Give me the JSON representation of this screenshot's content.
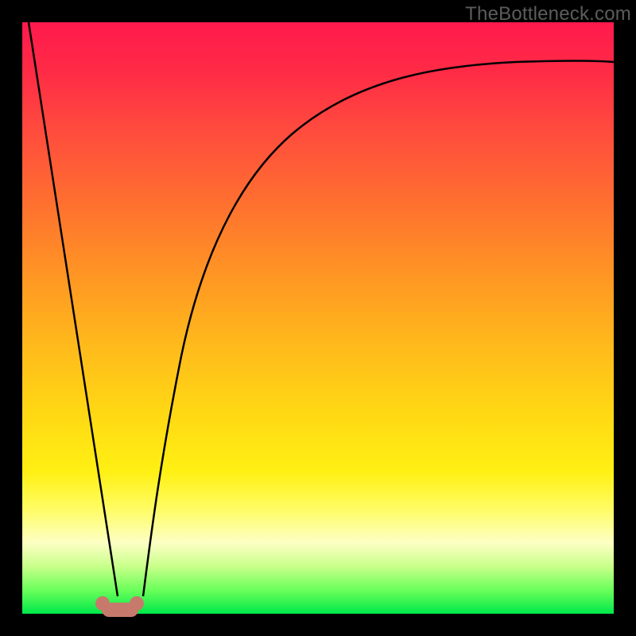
{
  "attribution": "TheBottleneck.com",
  "colors": {
    "background": "#000000",
    "gradient_top": "#ff1a4d",
    "gradient_bottom": "#00e84a",
    "curve": "#000000",
    "marker": "#c77a6b"
  },
  "chart_data": {
    "type": "line",
    "title": "",
    "xlabel": "",
    "ylabel": "",
    "xlim": [
      0,
      100
    ],
    "ylim": [
      0,
      100
    ],
    "grid": false,
    "legend": false,
    "notes": "Two curves on a vertical red→green gradient. Vertical axis reads as a percentage (red≈100 at top, green≈0 at bottom). Horizontal axis unlabeled but treated as 0–100. Values below are estimated from pixel positions.",
    "series": [
      {
        "name": "left-falling-line",
        "x": [
          1,
          5,
          10,
          14,
          16
        ],
        "values": [
          100,
          75,
          42,
          16,
          3
        ]
      },
      {
        "name": "right-rising-curve",
        "x": [
          20,
          22,
          25,
          30,
          35,
          40,
          50,
          60,
          70,
          80,
          90,
          100
        ],
        "values": [
          3,
          12,
          28,
          48,
          60,
          68,
          78,
          84,
          87.5,
          90,
          91.5,
          93
        ]
      }
    ],
    "marker": {
      "name": "minimum-region",
      "x_range": [
        14,
        20
      ],
      "y": 0
    }
  }
}
